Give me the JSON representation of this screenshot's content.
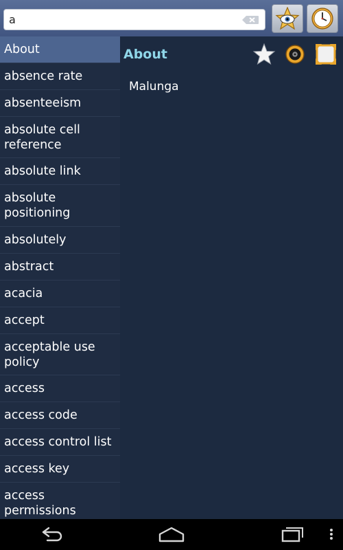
{
  "search": {
    "value": "a",
    "clear_icon": "backspace-clear-icon"
  },
  "toolbar": {
    "favorites_icon": "star-eye-icon",
    "history_icon": "clock-icon"
  },
  "sidebar": {
    "items": [
      {
        "label": "About",
        "selected": true
      },
      {
        "label": "absence rate"
      },
      {
        "label": "absenteeism"
      },
      {
        "label": "absolute cell reference"
      },
      {
        "label": "absolute link"
      },
      {
        "label": "absolute positioning"
      },
      {
        "label": "absolutely"
      },
      {
        "label": "abstract"
      },
      {
        "label": "acacia"
      },
      {
        "label": "accept"
      },
      {
        "label": "acceptable use policy"
      },
      {
        "label": "access"
      },
      {
        "label": "access code"
      },
      {
        "label": "access control list"
      },
      {
        "label": "access key"
      },
      {
        "label": "access permissions"
      }
    ]
  },
  "content": {
    "title": "About",
    "body": "Malunga",
    "actions": [
      "star-icon",
      "audio-icon",
      "fullscreen-icon"
    ]
  },
  "navbar": {
    "buttons": [
      "back-icon",
      "home-icon",
      "recent-apps-icon",
      "overflow-menu-icon"
    ]
  },
  "colors": {
    "title_accent": "#8fd6e8",
    "selected_item": "#4d6590",
    "background": "#1c2a40"
  }
}
